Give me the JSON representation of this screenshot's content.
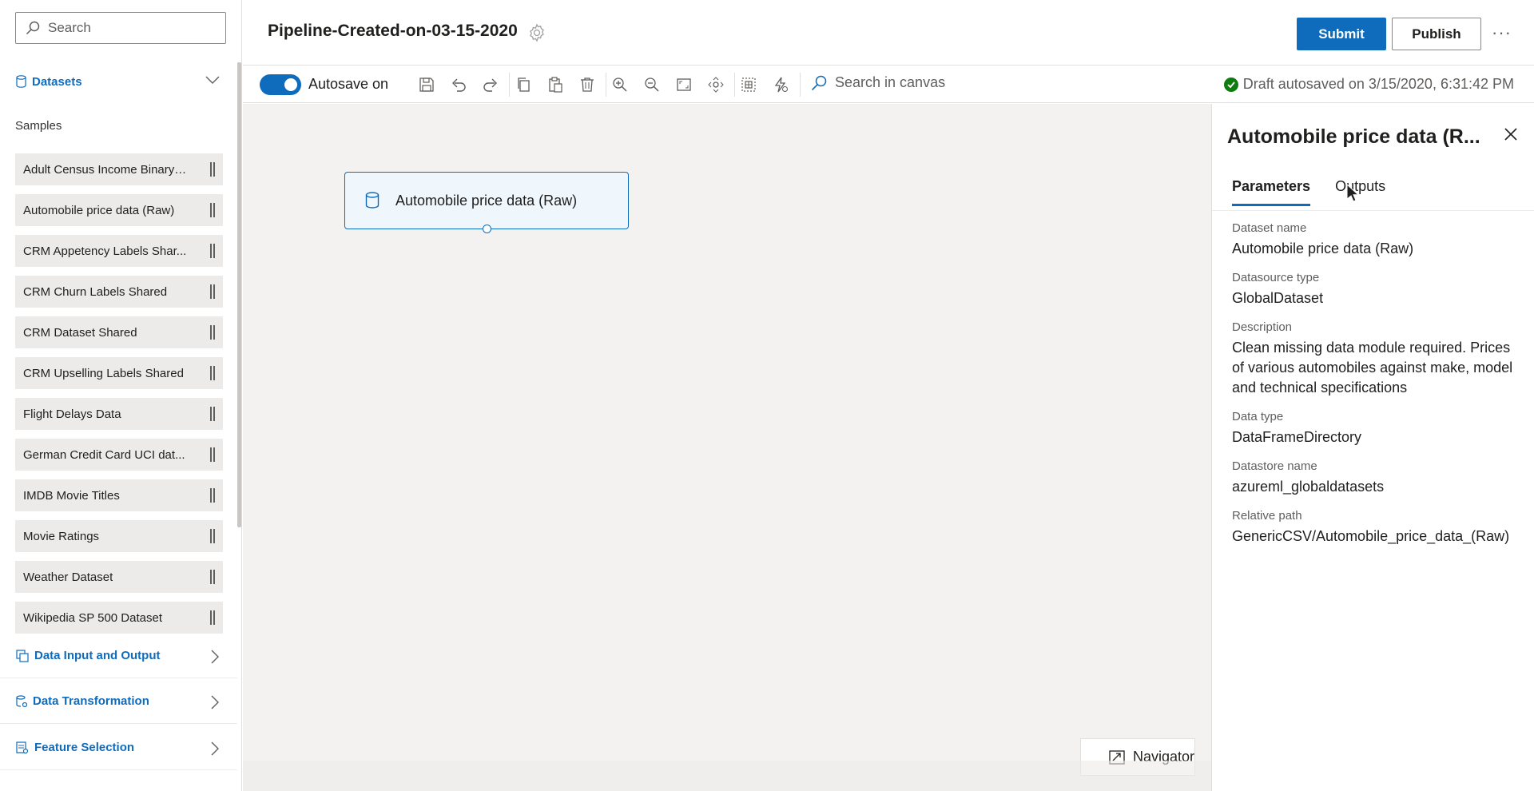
{
  "search": {
    "placeholder": "Search"
  },
  "sidebar": {
    "datasets_label": "Datasets",
    "samples_label": "Samples",
    "samples": [
      "Adult Census Income Binary ...",
      "Automobile price data (Raw)",
      "CRM Appetency Labels Shar...",
      "CRM Churn Labels Shared",
      "CRM Dataset Shared",
      "CRM Upselling Labels Shared",
      "Flight Delays Data",
      "German Credit Card UCI dat...",
      "IMDB Movie Titles",
      "Movie Ratings",
      "Weather Dataset",
      "Wikipedia SP 500 Dataset"
    ],
    "categories": [
      {
        "label": "Data Input and Output",
        "icon": "data-io-icon"
      },
      {
        "label": "Data Transformation",
        "icon": "data-transform-icon"
      },
      {
        "label": "Feature Selection",
        "icon": "feature-selection-icon"
      }
    ]
  },
  "header": {
    "title": "Pipeline-Created-on-03-15-2020",
    "submit_label": "Submit",
    "publish_label": "Publish",
    "more_label": "···"
  },
  "toolbar": {
    "autosave_label": "Autosave on",
    "canvas_search_placeholder": "Search in canvas",
    "status": "Draft autosaved on 3/15/2020, 6:31:42 PM"
  },
  "canvas": {
    "node_label": "Automobile price data (Raw)",
    "navigator_label": "Navigator"
  },
  "panel": {
    "title": "Automobile price data (R...",
    "tabs": [
      "Parameters",
      "Outputs"
    ],
    "params": [
      {
        "label": "Dataset name",
        "value": "Automobile price data (Raw)"
      },
      {
        "label": "Datasource type",
        "value": "GlobalDataset"
      },
      {
        "label": "Description",
        "value": "Clean missing data module required. Prices of various automobiles against make, model and technical specifications"
      },
      {
        "label": "Data type",
        "value": "DataFrameDirectory"
      },
      {
        "label": "Datastore name",
        "value": "azureml_globaldatasets"
      },
      {
        "label": "Relative path",
        "value": "GenericCSV/Automobile_price_data_(Raw)"
      }
    ]
  },
  "colors": {
    "accent": "#0f6cbd",
    "success": "#107c10"
  }
}
